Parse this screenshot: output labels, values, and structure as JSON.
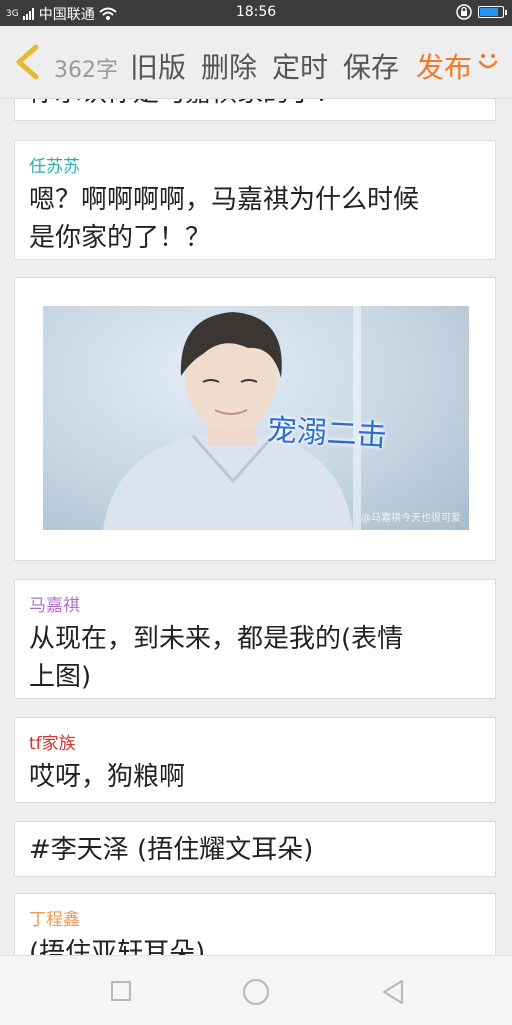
{
  "status_bar": {
    "carrier": "中国联通",
    "network": "3G",
    "time": "18:56"
  },
  "toolbar": {
    "char_count": "362字",
    "old_version": "旧版",
    "delete": "删除",
    "schedule": "定时",
    "save": "保存",
    "publish": "发布"
  },
  "story": {
    "cut_line": "你承认你是马嘉祺家的了！",
    "cards": [
      {
        "speaker": "任苏苏",
        "speaker_color": "#2aaeb2",
        "line1": "嗯？啊啊啊啊，马嘉祺为什么时候",
        "line2": "是你家的了！？"
      },
      {
        "image_caption": "宠溺二击",
        "watermark": "@马嘉祺今天也很可爱"
      },
      {
        "speaker": "马嘉祺",
        "speaker_color": "#b06fcf",
        "line1": "从现在，到未来，都是我的(表情",
        "line2": "上图)"
      },
      {
        "speaker": "tf家族",
        "speaker_color": "#d9342b",
        "line1": "哎呀，狗粮啊"
      },
      {
        "line1": "#李天泽 (捂住耀文耳朵)"
      },
      {
        "speaker": "丁程鑫",
        "speaker_color": "#ef9a4e",
        "line1": "(捂住亚轩耳朵)"
      }
    ]
  },
  "icons": {
    "back": "chevron-left-icon",
    "smile": "smile-icon",
    "recent": "square-icon",
    "home": "circle-icon",
    "nav_back": "triangle-left-icon"
  },
  "colors": {
    "accent": "#f07a2a",
    "back_arrow": "#e8b830"
  }
}
